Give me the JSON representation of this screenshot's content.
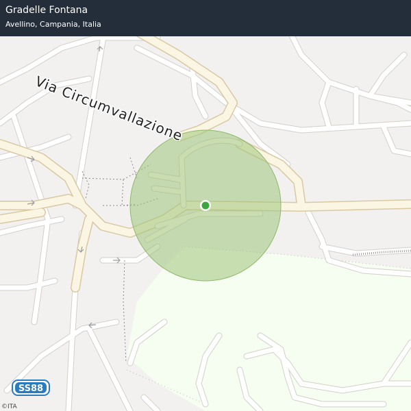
{
  "header": {
    "title": "Gradelle Fontana",
    "subtitle": "Avellino, Campania, Italia"
  },
  "map": {
    "street_label": "Via Circumvallazione",
    "road_shield": "SS88",
    "attribution": "©ITA",
    "colors": {
      "background": "#f2f1f0",
      "road": "#ffffff",
      "road_casing": "#d3cfca",
      "major_road": "#fbf5e3",
      "major_road_casing": "#d9c9a3",
      "green_area": "#f6fdf1",
      "highlight_circle": "#9ec47a",
      "marker": "#3ea640",
      "header": "#232e3a",
      "shield": "#2a7cc0"
    }
  }
}
